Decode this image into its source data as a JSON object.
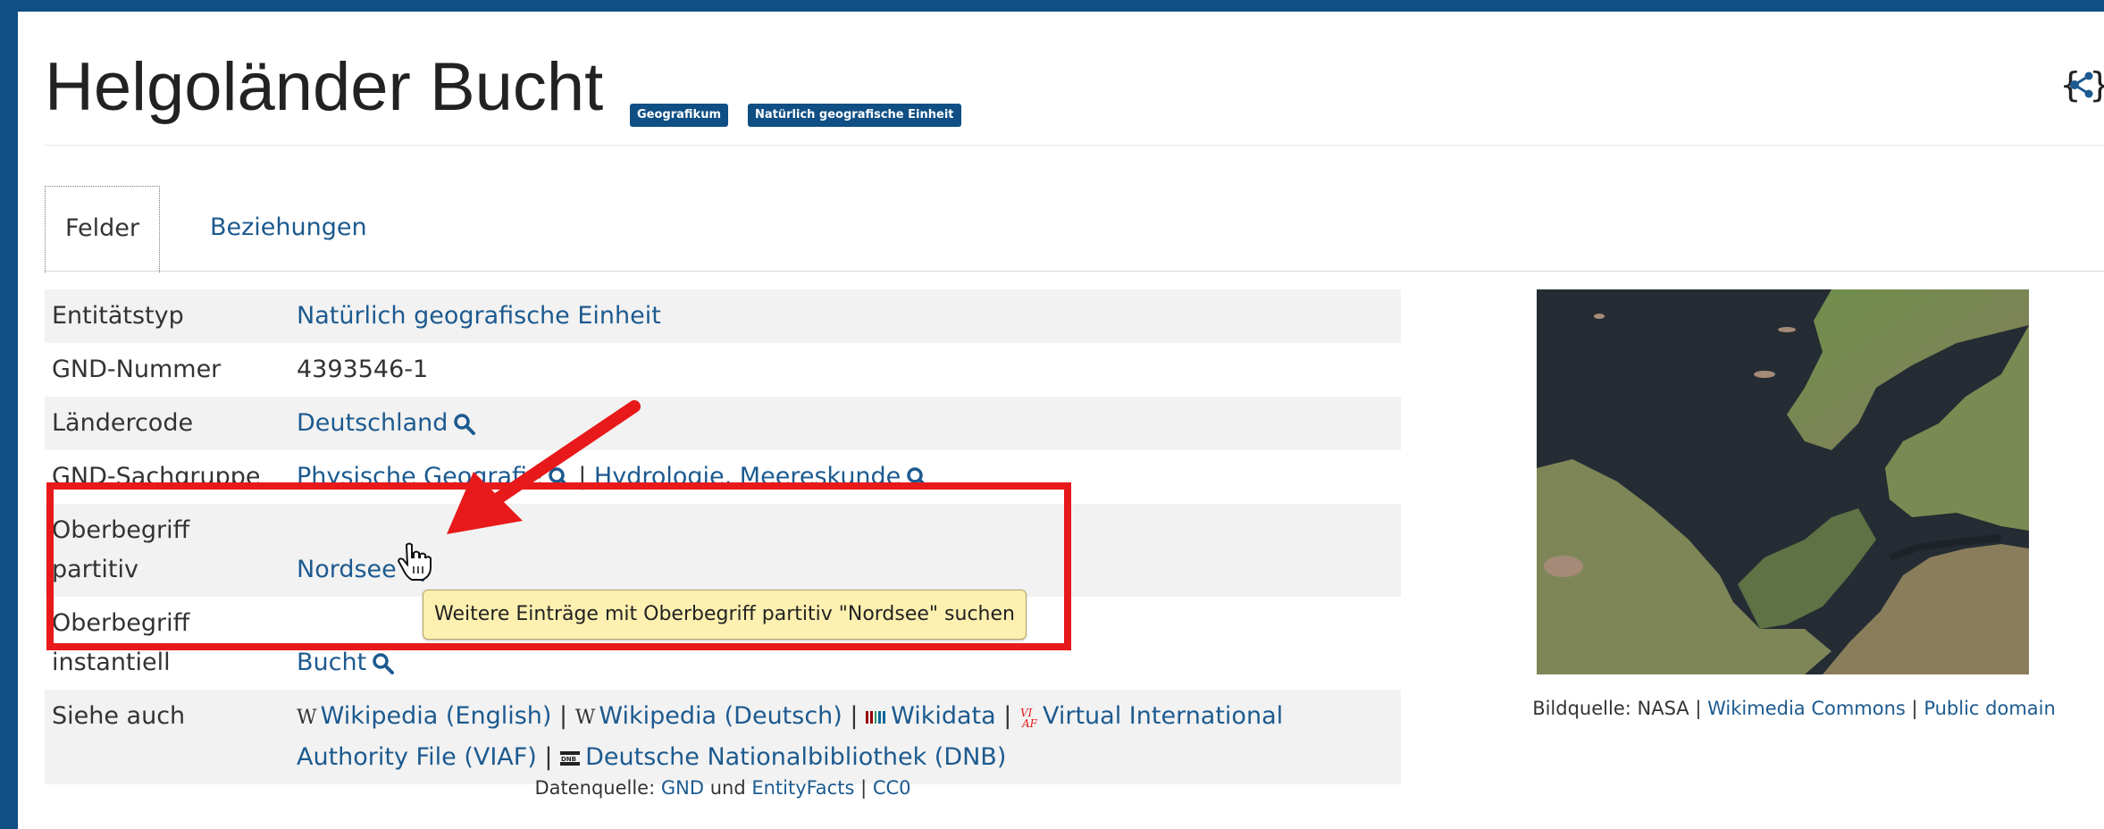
{
  "header": {
    "title": "Helgoländer Bucht",
    "badges": [
      "Geografikum",
      "Natürlich geografische Einheit"
    ],
    "graph_icon": "graph-icon"
  },
  "tabs": [
    {
      "label": "Felder",
      "active": true
    },
    {
      "label": "Beziehungen",
      "active": false
    }
  ],
  "fields": {
    "entitaetstyp": {
      "key": "Entitätstyp",
      "value": "Natürlich geografische Einheit"
    },
    "gnd_nummer": {
      "key": "GND-Nummer",
      "value": "4393546-1"
    },
    "laendercode": {
      "key": "Ländercode",
      "value": "Deutschland"
    },
    "sachgruppe": {
      "key": "GND-Sachgruppe",
      "values": [
        "Physische Geografie",
        "Hydrologie, Meereskunde"
      ],
      "separator": "|"
    },
    "oberbegriff_partitiv": {
      "key_line1": "Oberbegriff",
      "key_line2": "partitiv",
      "value": "Nordsee"
    },
    "oberbegriff_instantiell": {
      "key_line1": "Oberbegriff",
      "key_line2": "instantiell",
      "value": "Bucht"
    },
    "siehe_auch": {
      "key": "Siehe auch",
      "links": [
        "Wikipedia (English)",
        "Wikipedia (Deutsch)",
        "Wikidata",
        "Virtual International Authority File (VIAF)",
        "Deutsche Nationalbibliothek (DNB)"
      ],
      "separator": "|"
    }
  },
  "tooltip": "Weitere Einträge mit Oberbegriff partitiv \"Nordsee\" suchen",
  "image_caption": {
    "prefix": "Bildquelle: NASA",
    "separator": "|",
    "links": [
      "Wikimedia Commons",
      "Public domain"
    ]
  },
  "footer": {
    "prefix": "Datenquelle:",
    "link1": "GND",
    "middle": "und",
    "link2": "EntityFacts",
    "separator": "|",
    "license": "CC0"
  },
  "colors": {
    "frame": "#0f4f84",
    "link": "#1c5a8f",
    "highlight": "#e8191a",
    "tooltip_bg": "#fdf0b0"
  },
  "icons": [
    "search-icon",
    "wikipedia-icon",
    "wikidata-icon",
    "viaf-icon",
    "dnb-icon",
    "graph-icon",
    "hand-cursor-icon",
    "red-arrow"
  ]
}
